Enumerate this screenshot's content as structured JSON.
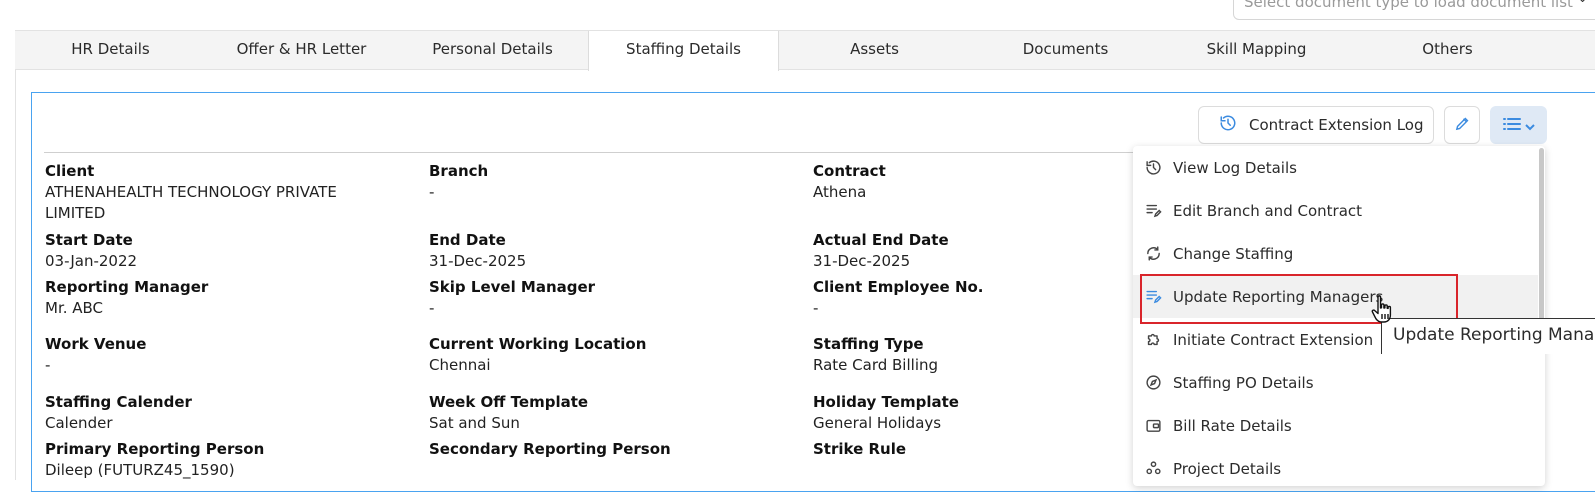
{
  "document_select": {
    "placeholder": "Select document type to load document list"
  },
  "tabs": [
    {
      "label": "HR Details"
    },
    {
      "label": "Offer & HR Letter"
    },
    {
      "label": "Personal Details"
    },
    {
      "label": "Staffing Details",
      "active": true
    },
    {
      "label": "Assets"
    },
    {
      "label": "Documents"
    },
    {
      "label": "Skill Mapping"
    },
    {
      "label": "Others"
    }
  ],
  "toolbar": {
    "contract_extension_log": "Contract Extension Log"
  },
  "fields": {
    "client": {
      "label": "Client",
      "value_line1": "ATHENAHEALTH TECHNOLOGY PRIVATE",
      "value_line2": "LIMITED"
    },
    "branch": {
      "label": "Branch",
      "value": "-"
    },
    "contract": {
      "label": "Contract",
      "value": "Athena"
    },
    "start_date": {
      "label": "Start Date",
      "value": "03-Jan-2022"
    },
    "end_date": {
      "label": "End Date",
      "value": "31-Dec-2025"
    },
    "actual_end_date": {
      "label": "Actual End Date",
      "value": "31-Dec-2025"
    },
    "reporting_manager": {
      "label": "Reporting Manager",
      "value": "Mr. ABC"
    },
    "skip_level_manager": {
      "label": "Skip Level Manager",
      "value": "-"
    },
    "client_employee_no": {
      "label": "Client Employee No.",
      "value": "-"
    },
    "work_venue": {
      "label": "Work Venue",
      "value": "-"
    },
    "current_working_location": {
      "label": "Current Working Location",
      "value": "Chennai"
    },
    "staffing_type": {
      "label": "Staffing Type",
      "value": "Rate Card Billing"
    },
    "staffing_calender": {
      "label": "Staffing Calender",
      "value": "Calender"
    },
    "week_off_template": {
      "label": "Week Off Template",
      "value": "Sat and Sun"
    },
    "holiday_template": {
      "label": "Holiday Template",
      "value": "General Holidays"
    },
    "primary_reporting_person": {
      "label": "Primary Reporting Person",
      "value": "Dileep (FUTURZ45_1590)"
    },
    "secondary_reporting_person": {
      "label": "Secondary Reporting Person"
    },
    "strike_rule": {
      "label": "Strike Rule"
    }
  },
  "menu": {
    "items": [
      {
        "label": "View Log Details",
        "icon": "history-icon"
      },
      {
        "label": "Edit Branch and Contract",
        "icon": "edit-list-icon"
      },
      {
        "label": "Change Staffing",
        "icon": "refresh-icon"
      },
      {
        "label": "Update Reporting Managers",
        "icon": "edit-list-icon",
        "hovered": true
      },
      {
        "label": "Initiate Contract Extension",
        "icon": "puzzle-icon"
      },
      {
        "label": "Staffing PO Details",
        "icon": "compass-icon"
      },
      {
        "label": "Bill Rate Details",
        "icon": "wallet-icon"
      },
      {
        "label": "Project Details",
        "icon": "people-icon"
      }
    ]
  },
  "tooltip": {
    "text": "Update Reporting Managers"
  },
  "colors": {
    "accent": "#4aa3f0",
    "highlight": "#d9252b",
    "menu_button_bg": "#dfe9f5"
  }
}
